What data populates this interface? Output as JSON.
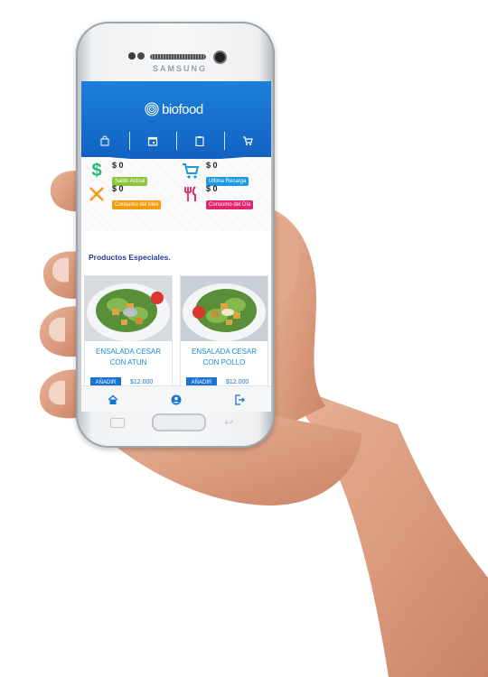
{
  "device": {
    "brand": "SAMSUNG"
  },
  "app": {
    "logo_text": "biofood"
  },
  "nav": [
    {
      "icon": "shopping-bag-icon"
    },
    {
      "icon": "calendar-icon"
    },
    {
      "icon": "clipboard-icon"
    },
    {
      "icon": "cart-icon"
    }
  ],
  "stats": {
    "saldo": {
      "value": "$ 0",
      "label": "Saldo Actual",
      "color": "#8cc63f",
      "icon": "dollar-icon"
    },
    "recarga": {
      "value": "$ 0",
      "label": "Ultima Recarga",
      "color": "#1e9be0",
      "icon": "cart-icon"
    },
    "mes": {
      "value": "$ 0",
      "label": "Consumo del Mes",
      "color": "#f39c12",
      "icon": "utensils-icon"
    },
    "dia": {
      "value": "$ 0",
      "label": "Consumo del Día",
      "color": "#e6236e",
      "icon": "fork-knife-icon"
    }
  },
  "section_title": "Productos Especiales.",
  "products": [
    {
      "name_line1": "ENSALADA CESAR",
      "name_line2": "CON ATUN",
      "button": "AÑADIR",
      "price": "$12.000"
    },
    {
      "name_line1": "ENSALADA CESAR",
      "name_line2": "CON POLLO",
      "button": "AÑADIR",
      "price": "$12.000"
    }
  ],
  "bottom_nav": [
    {
      "icon": "home-icon"
    },
    {
      "icon": "user-icon"
    },
    {
      "icon": "logout-icon"
    }
  ],
  "colors": {
    "primary": "#1a73d1",
    "link": "#1a8bd8",
    "title": "#233b8f"
  }
}
